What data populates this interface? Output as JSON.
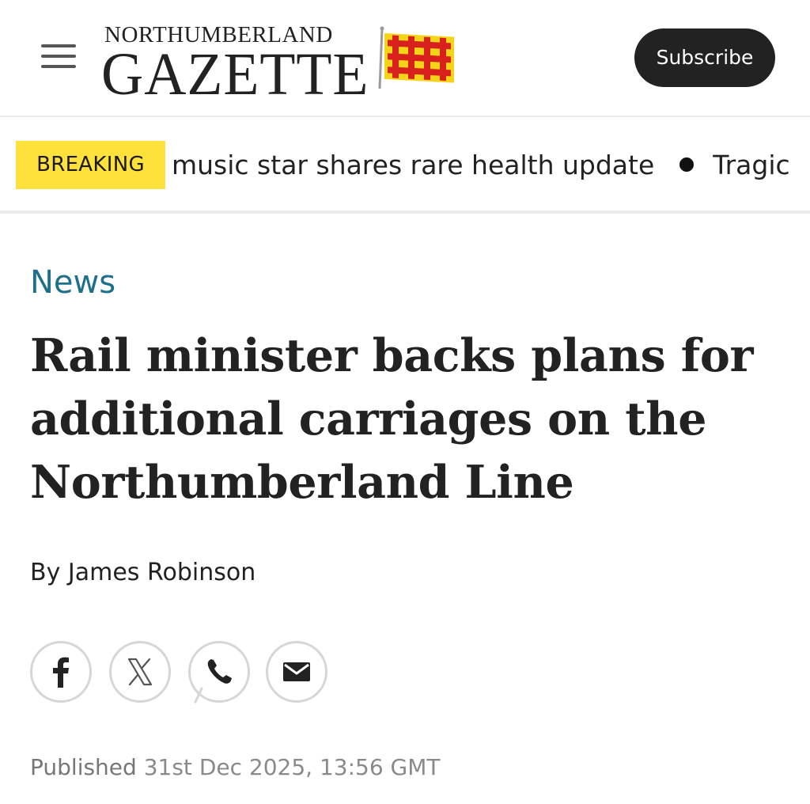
{
  "header": {
    "menu_icon": "hamburger-menu-icon",
    "logo_top": "NORTHUMBERLAND",
    "logo_main": "GAZETTE",
    "logo_flag_icon": "northumberland-flag-icon",
    "logo_flag_colors": [
      "#f5d418",
      "#d8211d"
    ],
    "subscribe_label": "Subscribe"
  },
  "ticker": {
    "badge_label": "BREAKING",
    "badge_color": "#ffe13b",
    "items": [
      "music star shares rare health update",
      "Tragic"
    ]
  },
  "article": {
    "category": "News",
    "category_color": "#1e6f8a",
    "headline": "Rail minister backs plans for additional carriages on the Northumberland Line",
    "byline_prefix": "By",
    "author": "James Robinson",
    "share_icons": [
      "facebook-icon",
      "x-icon",
      "whatsapp-icon",
      "email-icon"
    ],
    "published_label": "Published",
    "published_date": "31st Dec 2025, 13:56 GMT"
  }
}
